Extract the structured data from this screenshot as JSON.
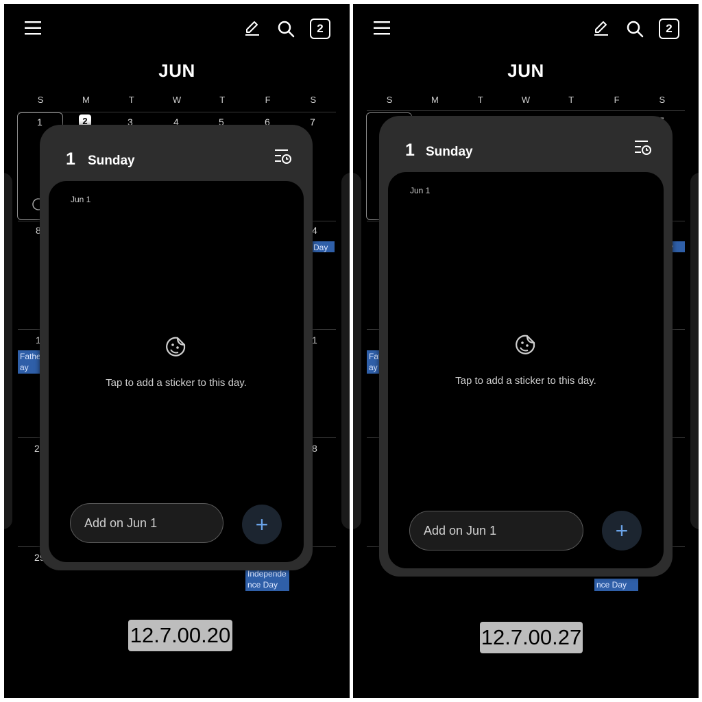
{
  "left": {
    "month": "JUN",
    "today_badge": "2",
    "weekdays": [
      "S",
      "M",
      "T",
      "W",
      "T",
      "F",
      "S"
    ],
    "week1": [
      "1",
      "2",
      "3",
      "4",
      "5",
      "6",
      "7"
    ],
    "row2_left": "8",
    "row2_right": "4",
    "row3_left": "1",
    "row3_right": "1",
    "row4_left": "2",
    "row4_right": "8",
    "row5_left": "29",
    "event_day": "Day",
    "event_fathers": "Father\nay",
    "event_independence": "Independe\nnce Day",
    "sheet": {
      "day_number": "1",
      "day_name": "Sunday",
      "inner_date": "Jun 1",
      "sticker_hint": "Tap to add a sticker to this day.",
      "add_placeholder": "Add on Jun 1",
      "add_symbol": "+"
    },
    "version": "12.7.00.20"
  },
  "right": {
    "month": "JUN",
    "today_badge": "2",
    "weekdays": [
      "S",
      "M",
      "T",
      "W",
      "T",
      "F",
      "S"
    ],
    "week1_last": "7",
    "event_day": "y",
    "event_fathers": "Fat\nay",
    "event_independence": "nce Day",
    "sheet": {
      "day_number": "1",
      "day_name": "Sunday",
      "inner_date": "Jun 1",
      "sticker_hint": "Tap to add a sticker to this day.",
      "add_placeholder": "Add on Jun 1",
      "add_symbol": "+"
    },
    "version": "12.7.00.27"
  },
  "colors": {
    "background": "#000000",
    "sheet": "#2d2d2d",
    "event_chip": "#2f5fa8",
    "accent": "#6aa3e8"
  }
}
